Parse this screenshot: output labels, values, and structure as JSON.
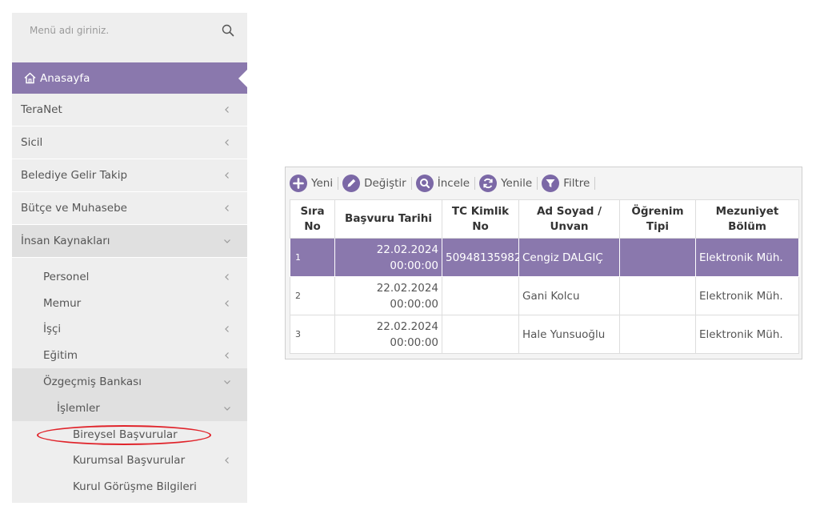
{
  "sidebar": {
    "search": {
      "placeholder": "Menü adı giriniz."
    },
    "home_label": "Anasayfa",
    "items": [
      {
        "label": "TeraNet"
      },
      {
        "label": "Sicil"
      },
      {
        "label": "Belediye Gelir Takip"
      },
      {
        "label": "Bütçe ve Muhasebe"
      },
      {
        "label": "İnsan Kaynakları"
      }
    ],
    "sub_items": [
      {
        "label": "Personel"
      },
      {
        "label": "Memur"
      },
      {
        "label": "İşçi"
      },
      {
        "label": "Eğitim"
      },
      {
        "label": "Özgeçmiş Bankası"
      }
    ],
    "islemler_label": "İşlemler",
    "leaf_items": [
      {
        "label": "Bireysel Başvurular"
      },
      {
        "label": "Kurumsal Başvurular"
      },
      {
        "label": "Kurul Görüşme Bilgileri"
      }
    ]
  },
  "toolbar": {
    "new_label": "Yeni",
    "edit_label": "Değiştir",
    "inspect_label": "İncele",
    "refresh_label": "Yenile",
    "filter_label": "Filtre"
  },
  "table": {
    "headers": {
      "no_line1": "Sıra",
      "no_line2": "No",
      "date": "Başvuru Tarihi",
      "tc": "TC Kimlik No",
      "name_line1": "Ad Soyad /",
      "name_line2": "Unvan",
      "edu_line1": "Öğrenim",
      "edu_line2": "Tipi",
      "dept_line1": "Mezuniyet",
      "dept_line2": "Bölüm"
    },
    "rows": [
      {
        "no": "1",
        "date": "22.02.2024",
        "time": "00:00:00",
        "tc": "50948135982",
        "name": "Cengiz DALGIÇ",
        "edu": "",
        "dept": "Elektronik Müh."
      },
      {
        "no": "2",
        "date": "22.02.2024",
        "time": "00:00:00",
        "tc": "",
        "name": "Gani Kolcu",
        "edu": "",
        "dept": "Elektronik Müh."
      },
      {
        "no": "3",
        "date": "22.02.2024",
        "time": "00:00:00",
        "tc": "",
        "name": "Hale Yunsuoğlu",
        "edu": "",
        "dept": "Elektronik Müh."
      }
    ]
  },
  "colors": {
    "accent": "#8a78ad",
    "toolbar_icon": "#7b68a6",
    "highlight": "#e0242b"
  }
}
